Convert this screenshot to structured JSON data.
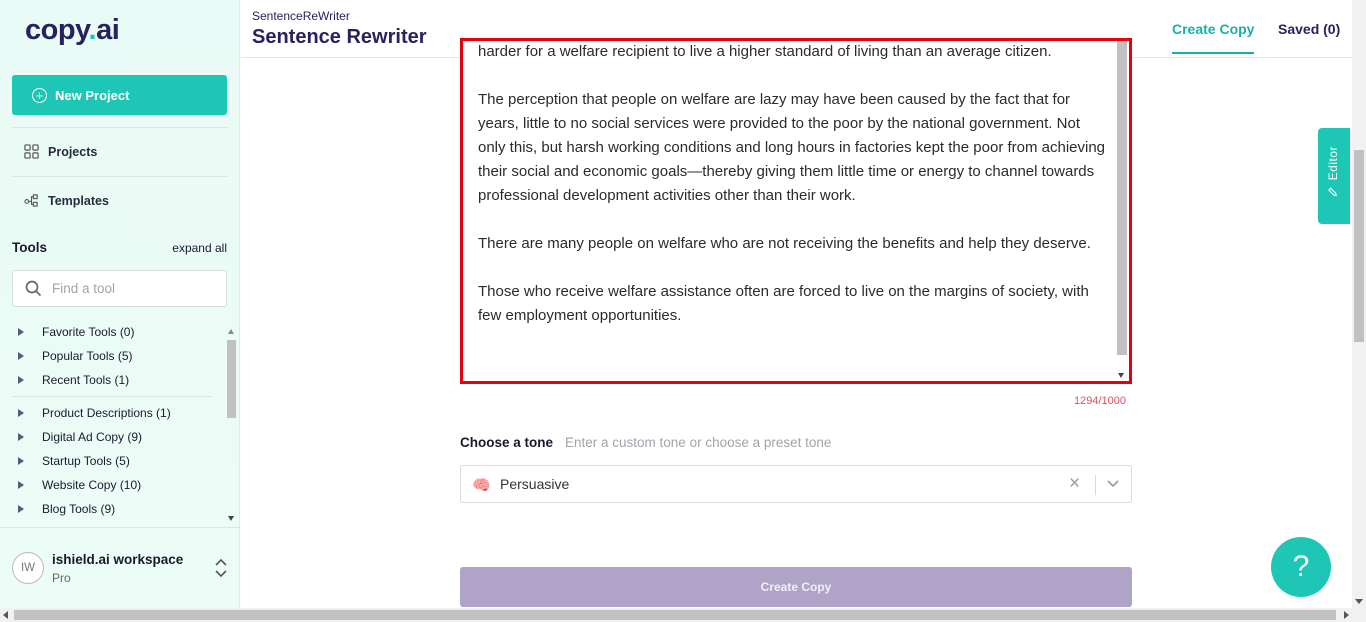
{
  "app": {
    "logo_main": "copy",
    "logo_dot": ".",
    "logo_suffix": "ai",
    "brand_color": "#28215f",
    "accent_color": "#1ec6b6"
  },
  "sidebar": {
    "new_project_label": "New Project",
    "nav": [
      {
        "label": "Projects",
        "icon": "grid-icon"
      },
      {
        "label": "Templates",
        "icon": "templates-icon"
      }
    ],
    "tools_title": "Tools",
    "expand_all": "expand all",
    "search_placeholder": "Find a tool",
    "tool_groups_top": [
      "Favorite Tools (0)",
      "Popular Tools (5)",
      "Recent Tools (1)"
    ],
    "tool_groups": [
      "Product Descriptions (1)",
      "Digital Ad Copy (9)",
      "Startup Tools (5)",
      "Website Copy (10)",
      "Blog Tools (9)"
    ],
    "workspace": {
      "initials": "IW",
      "name": "ishield.ai workspace",
      "plan": "Pro"
    }
  },
  "header": {
    "breadcrumb": "SentenceReWriter",
    "title": "Sentence Rewriter",
    "tabs": [
      {
        "label": "Create Copy",
        "active": true
      },
      {
        "label": "Saved (0)",
        "active": false
      }
    ]
  },
  "editor": {
    "paragraphs": [
      "harder for a welfare recipient to live a higher standard of living than an average citizen.",
      "The perception that people on welfare are lazy may have been caused by the fact that for years, little to no social services were provided to the poor by the national government. Not only this, but harsh working conditions and long hours in factories kept the poor from achieving their social and economic goals—thereby giving them little time or energy to channel towards professional development activities other than their work.",
      "There are many people on welfare who are not receiving the benefits and help they deserve.",
      "Those who receive welfare assistance often are forced to live on the margins of society, with few employment opportunities."
    ],
    "char_count": "1294/1000",
    "tone_label": "Choose a tone",
    "tone_hint": "Enter a custom tone or choose a preset tone",
    "tone_value": "Persuasive",
    "tone_icon": "brain-icon",
    "create_button": "Create Copy"
  },
  "side_tab": {
    "label": "Editor"
  },
  "help": {
    "label": "?"
  }
}
